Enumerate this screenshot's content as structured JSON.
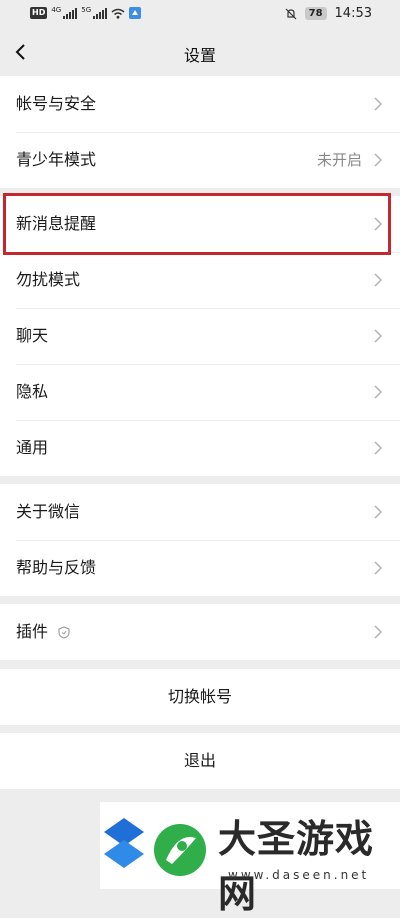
{
  "status_bar": {
    "hd": "HD",
    "net1": "4G",
    "net2": "5G",
    "battery": "78",
    "time": "14:53",
    "icons": [
      "hd-icon",
      "signal-icon",
      "signal-icon",
      "wifi-icon",
      "app-notify-icon",
      "mute-icon",
      "battery-icon"
    ]
  },
  "nav": {
    "title": "设置",
    "back_icon": "back-arrow-icon"
  },
  "groups": [
    {
      "items": [
        {
          "label": "帐号与安全"
        },
        {
          "label": "青少年模式",
          "value": "未开启"
        }
      ]
    },
    {
      "items": [
        {
          "label": "新消息提醒"
        },
        {
          "label": "勿扰模式"
        },
        {
          "label": "聊天"
        },
        {
          "label": "隐私"
        },
        {
          "label": "通用"
        }
      ]
    },
    {
      "items": [
        {
          "label": "关于微信"
        },
        {
          "label": "帮助与反馈"
        }
      ]
    },
    {
      "items": [
        {
          "label": "插件",
          "icon": "shield-icon"
        }
      ]
    }
  ],
  "actions": {
    "switch_account": "切换帐号",
    "logout": "退出"
  },
  "highlight_color": "#c4282e",
  "watermark": {
    "text": "大圣游戏网",
    "url": "www.daseen.net"
  }
}
